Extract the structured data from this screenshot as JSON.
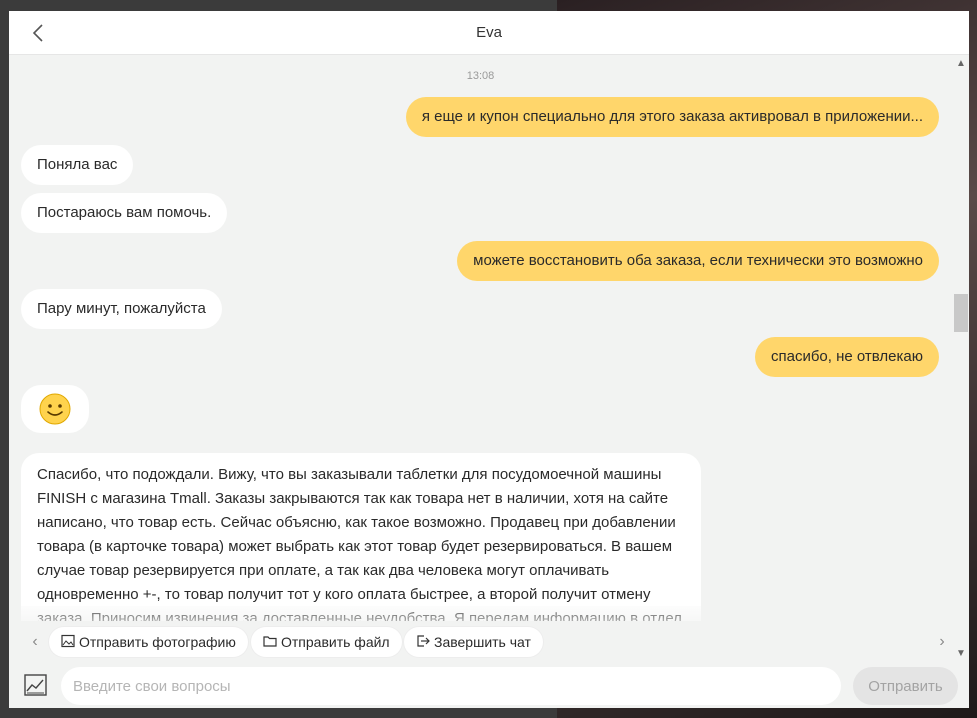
{
  "header": {
    "title": "Eva"
  },
  "chat": {
    "timestamp": "13:08",
    "messages": [
      {
        "from": "user",
        "text": "я еще и купон специально для этого заказа активровал в приложении..."
      },
      {
        "from": "agent",
        "text": "Поняла вас"
      },
      {
        "from": "agent",
        "text": "Постараюсь вам помочь."
      },
      {
        "from": "user",
        "text": "можете восстановить оба заказа, если технически это возможно"
      },
      {
        "from": "agent",
        "text": "Пару минут, пожалуйста"
      },
      {
        "from": "user",
        "text": "спасибо, не отвлекаю"
      },
      {
        "from": "agent",
        "text": "🙂"
      },
      {
        "from": "agent",
        "text": "Спасибо, что подождали. Вижу, что вы заказывали таблетки для посудомоечной машины FINISH с магазина Tmall. Заказы закрываются так как товара нет в наличии, хотя на сайте написано, что товар есть. Сейчас объясню, как такое возможно. Продавец при добавлении товара (в карточке товара) может выбрать как этот товар будет резервироваться. В вашем случае товар резервируется при оплате, а так как два человека могут оплачивать одновременно +-, то товар получит тот у кого оплата быстрее, а второй получит отмену заказа. Приносим извинения за доставленные неудобства. Я передам информацию в отдел по решению вашего вопроса и чтобы они предоставили вам дополнительную информацию по вашим заказам"
      }
    ]
  },
  "quick_actions": [
    {
      "label": "Отправить фотографию",
      "icon": "image-icon"
    },
    {
      "label": "Отправить файл",
      "icon": "folder-icon"
    },
    {
      "label": "Завершить чат",
      "icon": "exit-icon"
    }
  ],
  "composer": {
    "placeholder": "Введите свои вопросы",
    "send_label": "Отправить"
  },
  "colors": {
    "user_bubble": "#ffd66b",
    "agent_bubble": "#ffffff",
    "chat_background": "#f2f3f2"
  }
}
